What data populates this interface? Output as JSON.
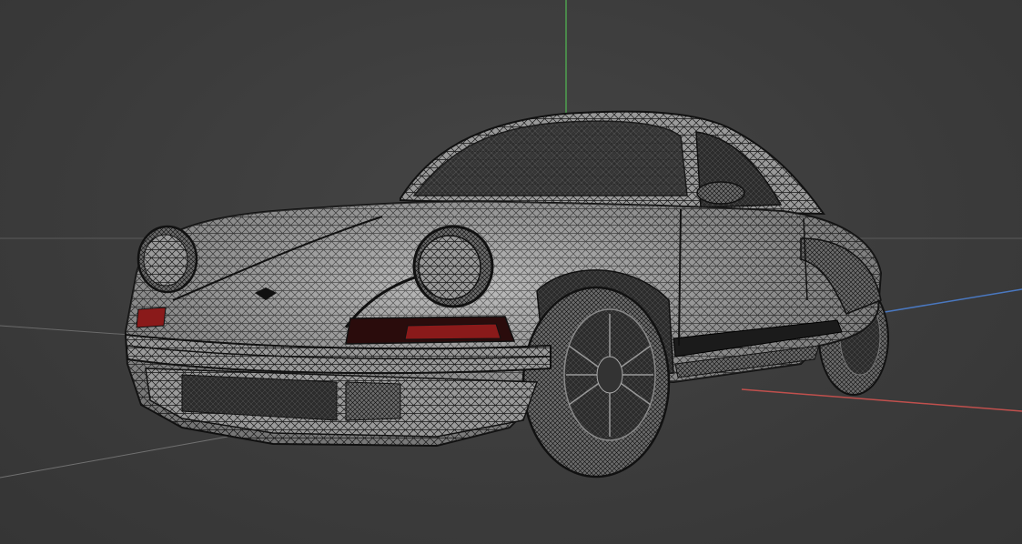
{
  "viewport": {
    "view_mode": "wireframe",
    "subject": "car-model",
    "background_color": "#3d3d3d",
    "axis_colors": {
      "x": "#c0504d",
      "y": "#4fa04f",
      "z": "#4a78c0"
    },
    "grid_color": "#5a5a5a",
    "mesh_line_color": "#111111",
    "body_color": "#8c8c8c",
    "tail_light_color": "#8a1a1a"
  }
}
